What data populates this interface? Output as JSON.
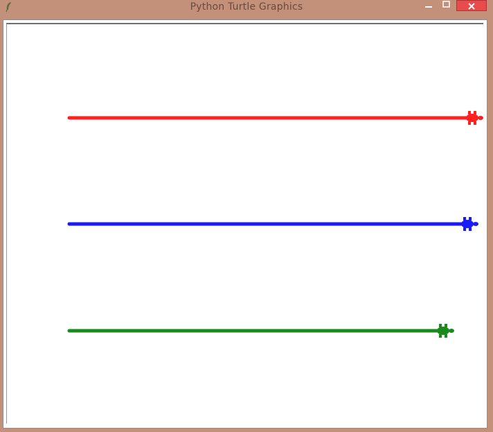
{
  "window": {
    "title": "Python Turtle Graphics",
    "icons": {
      "app": "feather-icon",
      "minimize": "minimize-icon",
      "maximize": "maximize-icon",
      "close": "close-icon"
    },
    "colors": {
      "frame": "#c3917a",
      "close": "#e74b4b",
      "canvas": "#ffffff"
    }
  },
  "turtles": [
    {
      "name": "red",
      "color": "#ff2020"
    },
    {
      "name": "blue",
      "color": "#1a1aff"
    },
    {
      "name": "green",
      "color": "#1a8a1a"
    }
  ]
}
